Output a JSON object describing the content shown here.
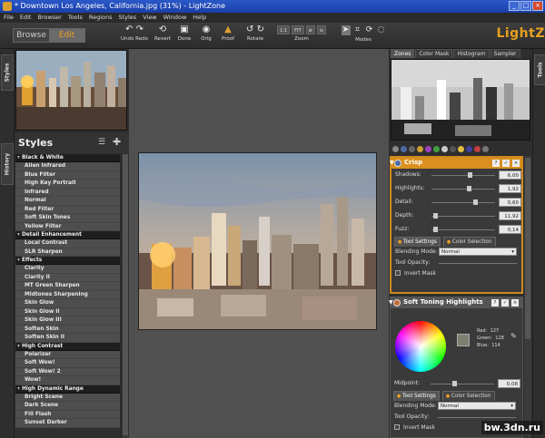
{
  "window": {
    "title": "* Downtown Los Angeles, California.jpg (31%) - LightZone",
    "buttons": [
      "_",
      "□",
      "×"
    ]
  },
  "menu": [
    "File",
    "Edit",
    "Browser",
    "Tools",
    "Regions",
    "Styles",
    "View",
    "Window",
    "Help"
  ],
  "toolbar": {
    "mode_browse": "Browse",
    "mode_edit": "Edit",
    "undo_redo": "Undo Redo",
    "revert": "Revert",
    "done": "Done",
    "orig": "Orig",
    "proof": "Proof",
    "rotate": "Rotate",
    "zoom_label": "Zoom",
    "zoom_one": "1:1",
    "zoom_fit": "FIT",
    "modes_label": "Modes",
    "brand": "LightZ"
  },
  "left_tabs": {
    "styles": "Styles",
    "history": "History"
  },
  "styles": {
    "title": "Styles",
    "groups": [
      {
        "name": "Black & White",
        "items": [
          "Alien Infrared",
          "Blue Filter",
          "High Key Portrait",
          "Infrared",
          "Normal",
          "Red Filter",
          "Soft Skin Tones",
          "Yellow Filter"
        ]
      },
      {
        "name": "Detail Enhancement",
        "items": [
          "Local Contrast",
          "SLR Sharpen"
        ]
      },
      {
        "name": "Effects",
        "items": [
          "Clarity",
          "Clarity II",
          "MT Green Sharpen",
          "Midtones Sharpening",
          "Skin Glow",
          "Skin Glow II",
          "Skin Glow III",
          "Soften Skin",
          "Soften Skin II"
        ]
      },
      {
        "name": "High Contrast",
        "items": [
          "Polarizer",
          "Soft Wow!",
          "Soft Wow! 2",
          "Wow!"
        ]
      },
      {
        "name": "High Dynamic Range",
        "items": [
          "Bright Scene",
          "Dark Scene",
          "Fill Flash",
          "Sunset Darker"
        ]
      }
    ]
  },
  "right_tabs": [
    "Zones",
    "Color Mask",
    "Histogram",
    "Sampler"
  ],
  "right_side_tab": "Tools",
  "tools": {
    "crisp": {
      "title": "Crisp",
      "sliders": [
        {
          "label": "Shadows:",
          "value": "6,00",
          "level": 0.62
        },
        {
          "label": "Highlights:",
          "value": "1,92",
          "level": 0.6
        },
        {
          "label": "Detail:",
          "value": "0,60",
          "level": 0.7
        },
        {
          "label": "Depth:",
          "value": "11,92",
          "level": 0.03
        },
        {
          "label": "Fuzz:",
          "value": "0,14",
          "level": 0.03
        }
      ],
      "tab_settings": "Tool Settings",
      "tab_color": "Color Selection",
      "blend_label": "Blending Mode:",
      "blend_value": "Normal",
      "opacity_label": "Tool Opacity:",
      "invert_label": "Invert Mask"
    },
    "soft_toning": {
      "title": "Soft Toning Highlights",
      "red_label": "Red:",
      "red": "127",
      "green_label": "Green:",
      "green": "128",
      "blue_label": "Blue:",
      "blue": "114",
      "midpoint_label": "Midpoint:",
      "midpoint_value": "0,08",
      "tab_settings": "Tool Settings",
      "tab_color": "Color Selection",
      "blend_label": "Blending Mode:",
      "blend_value": "Normal",
      "opacity_label": "Tool Opacity:",
      "invert_label": "Invert Mask"
    }
  },
  "watermark": "bw.3dn.ru"
}
